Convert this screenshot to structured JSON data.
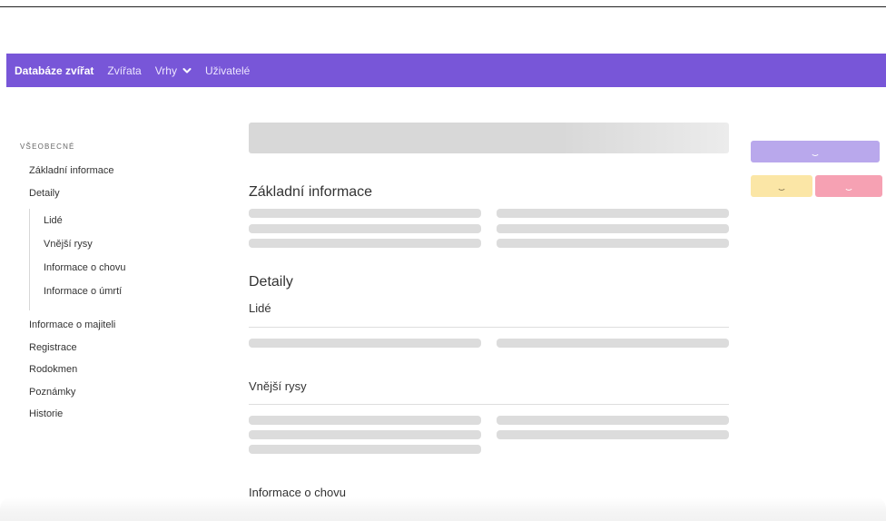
{
  "navbar": {
    "brand": "Databáze zvířat",
    "links": [
      "Zvířata",
      "Vrhy",
      "Uživatelé"
    ],
    "dropdown_icon": "chevron-down-icon",
    "color": "#7856d8"
  },
  "sidebar": {
    "heading": "VŠEOBECNÉ",
    "items": [
      "Základní informace",
      "Detaily"
    ],
    "sub_items": [
      "Lidé",
      "Vnější rysy",
      "Informace o chovu",
      "Informace o úmrtí"
    ],
    "items_after": [
      "Informace o majiteli",
      "Registrace",
      "Rodokmen",
      "Poznámky",
      "Historie"
    ]
  },
  "main": {
    "sections": {
      "basic": "Základní informace",
      "details": "Detaily",
      "people": "Lidé",
      "appearance": "Vnější rysy",
      "breeding": "Informace o chovu"
    }
  },
  "actions": {
    "save_color": "#b9a8ec",
    "warn_color": "#fbe6a6",
    "danger_color": "#f6a1b3",
    "state": "loading"
  }
}
